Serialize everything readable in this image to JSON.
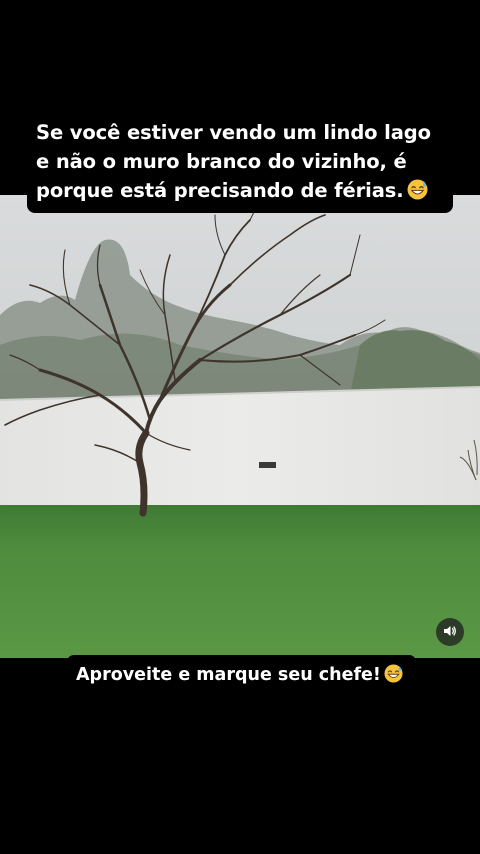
{
  "caption": {
    "lines": [
      "Se você estiver vendo um lindo lago",
      "e não o muro branco do vizinho, é",
      "porque está precisando de férias."
    ],
    "emoji": "grinning-face-with-sweat"
  },
  "cta": {
    "text": "Aproveite e marque seu chefe!",
    "emoji": "grinning-face-with-sweat"
  },
  "controls": {
    "volume_icon": "speaker-icon"
  },
  "colors": {
    "sky": "#d6d8d9",
    "wall": "#e6e6e4",
    "grass": "#4e8a3c",
    "caption_bg": "#000000",
    "caption_text": "#ffffff"
  }
}
